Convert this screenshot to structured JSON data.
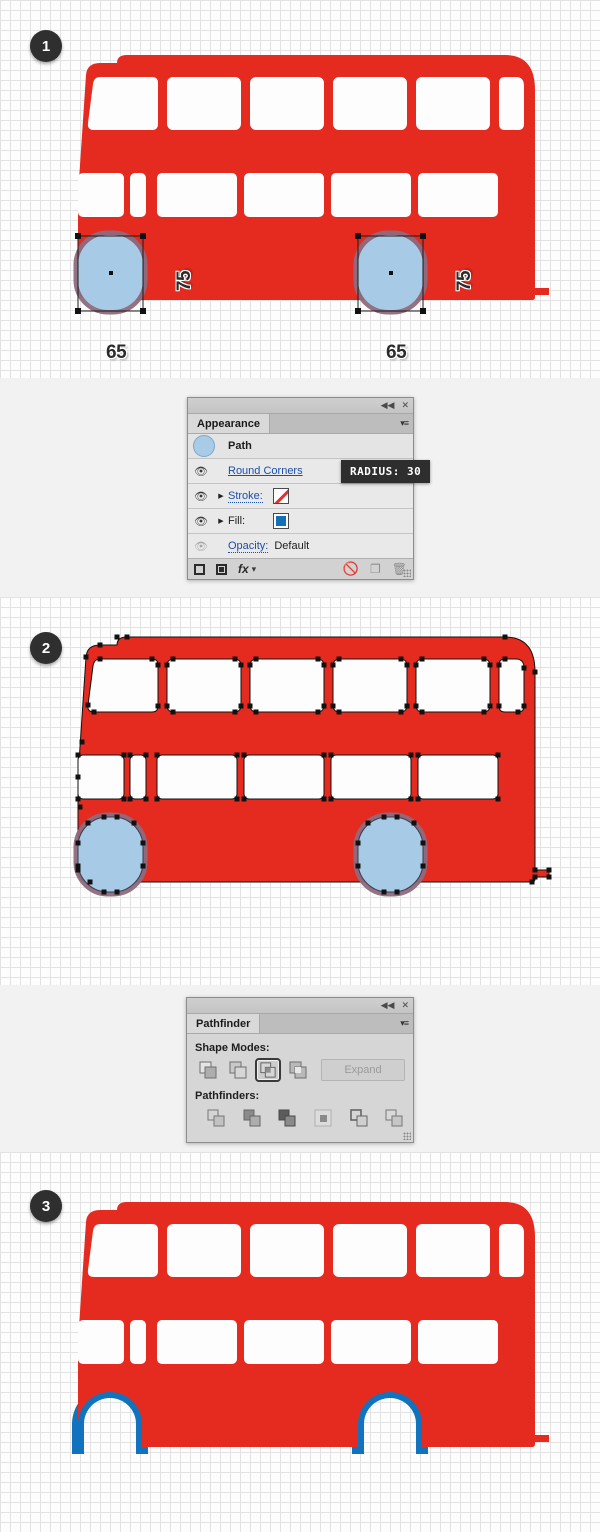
{
  "steps": [
    {
      "number": "1"
    },
    {
      "number": "2"
    },
    {
      "number": "3"
    }
  ],
  "measurements": {
    "left_wheel": {
      "width": "65",
      "height": "75"
    },
    "right_wheel": {
      "width": "65",
      "height": "75"
    }
  },
  "appearance_panel": {
    "title": "Appearance",
    "collapse_icon": "◀◀",
    "close_icon": "✕",
    "menu_icon": "▾≡",
    "target_label": "Path",
    "rows": [
      {
        "label": "Round Corners",
        "link": true,
        "dotted": false,
        "value": "",
        "eye": true,
        "arrow": false
      },
      {
        "label": "Stroke:",
        "link": true,
        "dotted": true,
        "value": "",
        "eye": true,
        "arrow": true
      },
      {
        "label": "Fill:",
        "link": false,
        "dotted": false,
        "value": "",
        "eye": true,
        "arrow": true
      },
      {
        "label": "Opacity:",
        "link": true,
        "dotted": true,
        "value": "Default",
        "eye": false,
        "arrow": false
      }
    ],
    "footer_icons": [
      "add-new-stroke-icon",
      "add-new-fill-icon",
      "fx-icon",
      "clear-appearance-icon",
      "duplicate-item-icon",
      "delete-item-icon"
    ],
    "fx_label": "fx",
    "tooltip": "RADIUS: 30"
  },
  "pathfinder_panel": {
    "title": "Pathfinder",
    "collapse_icon": "◀◀",
    "close_icon": "✕",
    "menu_icon": "▾≡",
    "shape_modes_label": "Shape Modes:",
    "pathfinders_label": "Pathfinders:",
    "expand_label": "Expand",
    "shape_modes": [
      {
        "name": "unite-icon",
        "selected": false
      },
      {
        "name": "minus-front-icon",
        "selected": false
      },
      {
        "name": "intersect-icon",
        "selected": true
      },
      {
        "name": "exclude-icon",
        "selected": false
      }
    ],
    "pathfinders": [
      {
        "name": "divide-icon"
      },
      {
        "name": "trim-icon"
      },
      {
        "name": "merge-icon"
      },
      {
        "name": "crop-icon"
      },
      {
        "name": "outline-icon"
      },
      {
        "name": "minus-back-icon"
      }
    ]
  },
  "colors": {
    "bus_red": "#E52B20",
    "wheel_fill": "#A7CBE7",
    "wheel_stroke": "#8E6B7E",
    "arch_blue": "#1173BE",
    "grid_line": "#E3E3E3",
    "canvas_bg": "#FDFDFD",
    "panel_bg": "#F2F2F2",
    "badge_bg": "#2F2F2F",
    "tooltip_bg": "#2E2E2E"
  },
  "artwork": {
    "bus_name": "double-decker-bus",
    "upper_windows_count": 6,
    "lower_windows_count": 6,
    "wheels_count": 2
  }
}
